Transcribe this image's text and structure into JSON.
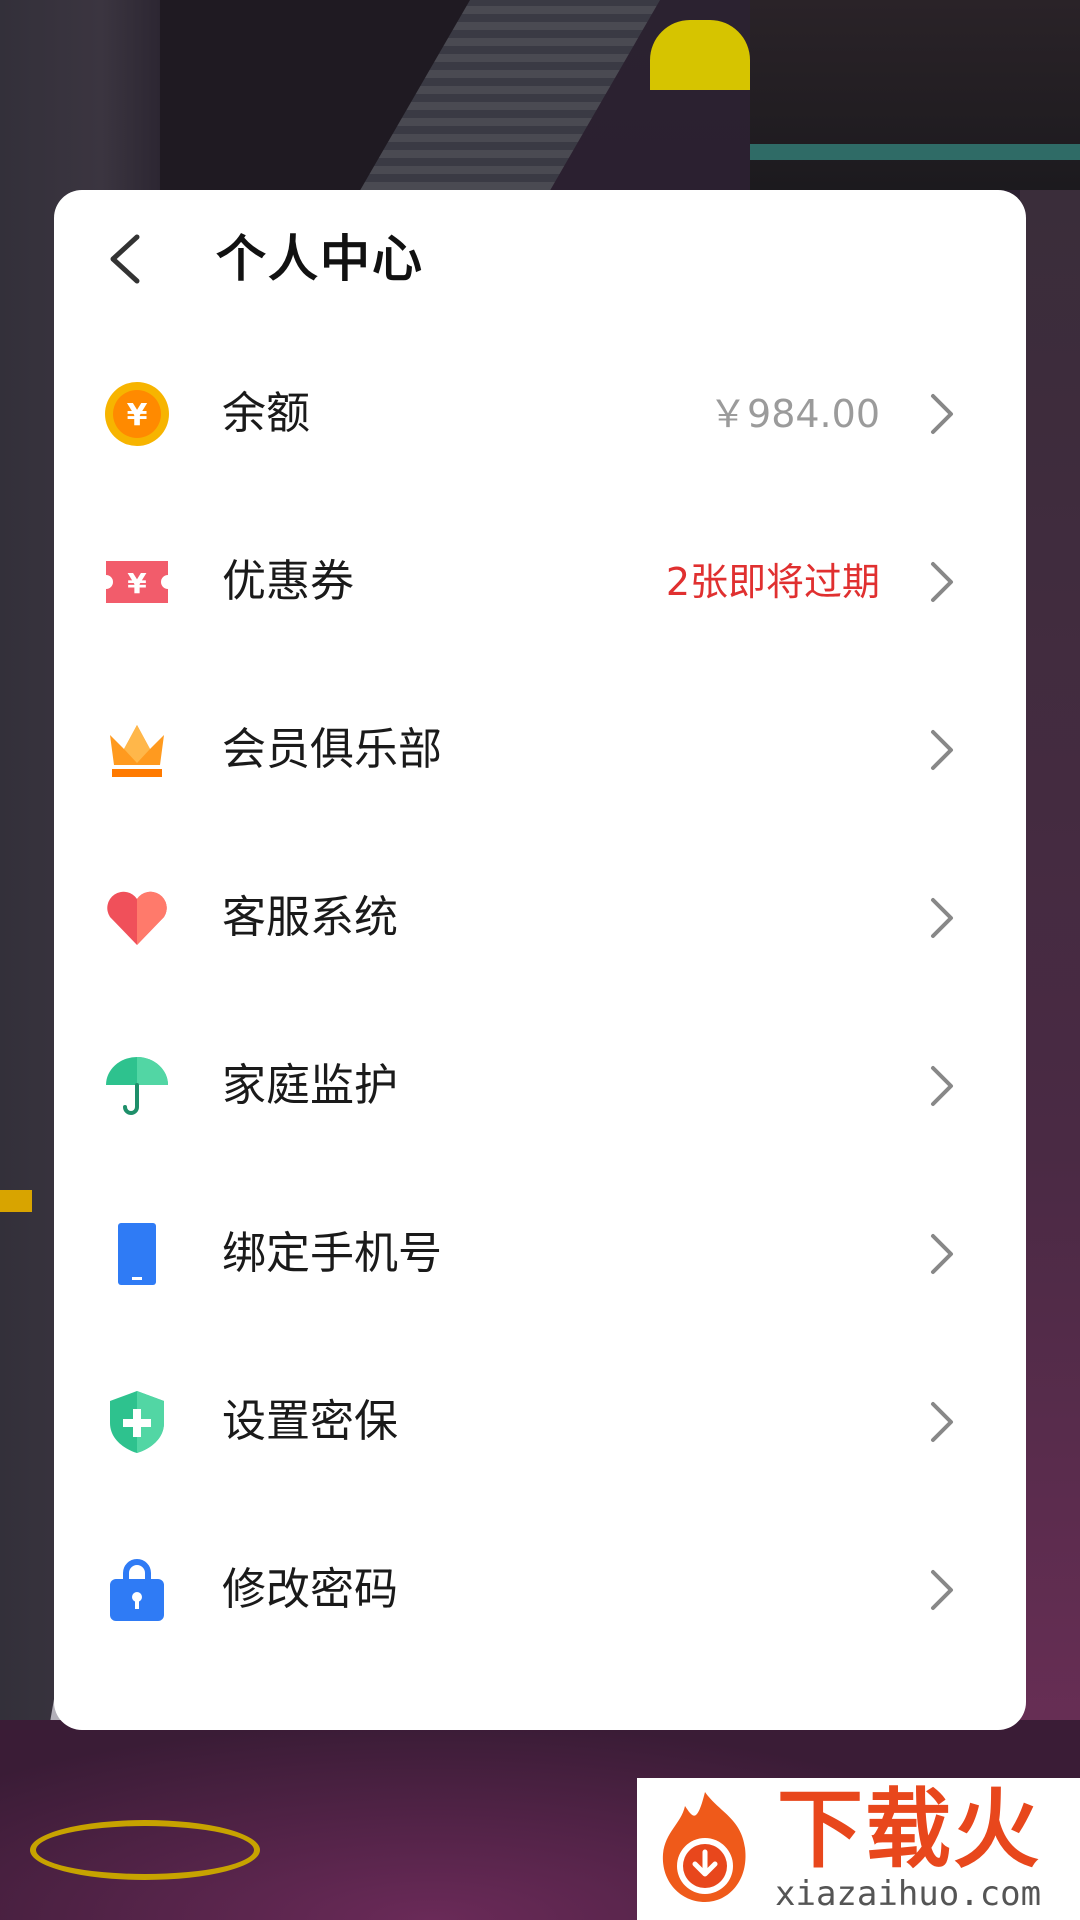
{
  "header": {
    "title": "个人中心"
  },
  "colors": {
    "accent_red": "#e03030",
    "muted_gray": "#9b9b9b",
    "panel_bg": "#ffffff"
  },
  "items": [
    {
      "label": "余额",
      "value": "￥984.00",
      "value_style": "gray",
      "icon": "coin-icon"
    },
    {
      "label": "优惠券",
      "value": "2张即将过期",
      "value_style": "red",
      "icon": "coupon-icon"
    },
    {
      "label": "会员俱乐部",
      "value": "",
      "icon": "crown-icon"
    },
    {
      "label": "客服系统",
      "value": "",
      "icon": "heart-icon"
    },
    {
      "label": "家庭监护",
      "value": "",
      "icon": "umbrella-icon"
    },
    {
      "label": "绑定手机号",
      "value": "",
      "icon": "phone-icon"
    },
    {
      "label": "设置密保",
      "value": "",
      "icon": "shield-icon"
    },
    {
      "label": "修改密码",
      "value": "",
      "icon": "lock-icon"
    }
  ],
  "watermark": {
    "brand": "下载火",
    "url": "xiazaihuo.com"
  }
}
